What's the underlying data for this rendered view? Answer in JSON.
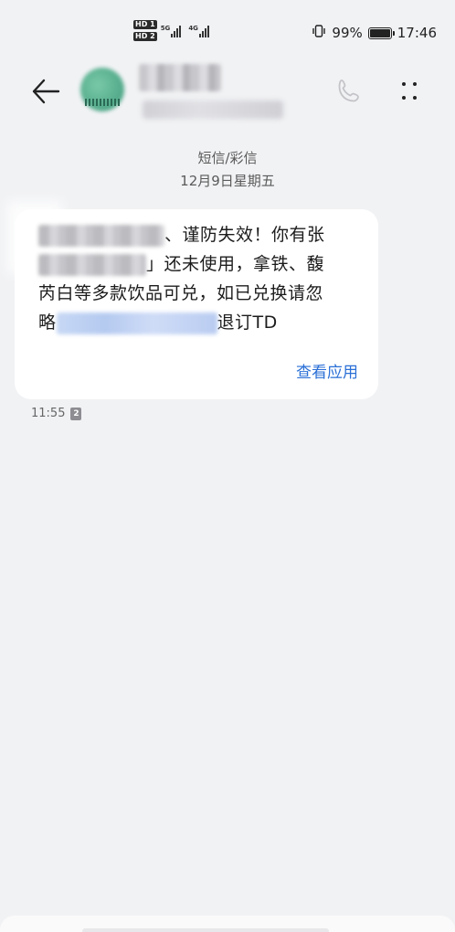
{
  "status_bar": {
    "sim1_badge": "HD 1",
    "sim2_badge": "HD 2",
    "sim1_network": "5G",
    "sim2_network": "4G",
    "battery_percent": "99%",
    "battery_level": 0.99,
    "time": "17:46",
    "icons": [
      "vibrate-icon",
      "battery-icon",
      "signal-icon"
    ]
  },
  "header": {
    "back_icon": "arrow-left-icon",
    "phone_icon": "phone-icon",
    "more_icon": "more-dots-icon"
  },
  "conversation": {
    "channel": "短信/彩信",
    "date": "12月9日星期五"
  },
  "message": {
    "line1_text": "谨防失效！你有张",
    "line2_text": "还未使用，拿铁、馥",
    "line3_text": "芮白等多款饮品可兑，如已兑换请忽",
    "line4_prefix": "略",
    "line4_suffix": "退订TD",
    "action_label": "查看应用",
    "time": "11:55",
    "sim_slot": "2"
  },
  "colors": {
    "background": "#f1f2f4",
    "bubble": "#ffffff",
    "link": "#2a6fd6",
    "text": "#1c1c1c"
  }
}
